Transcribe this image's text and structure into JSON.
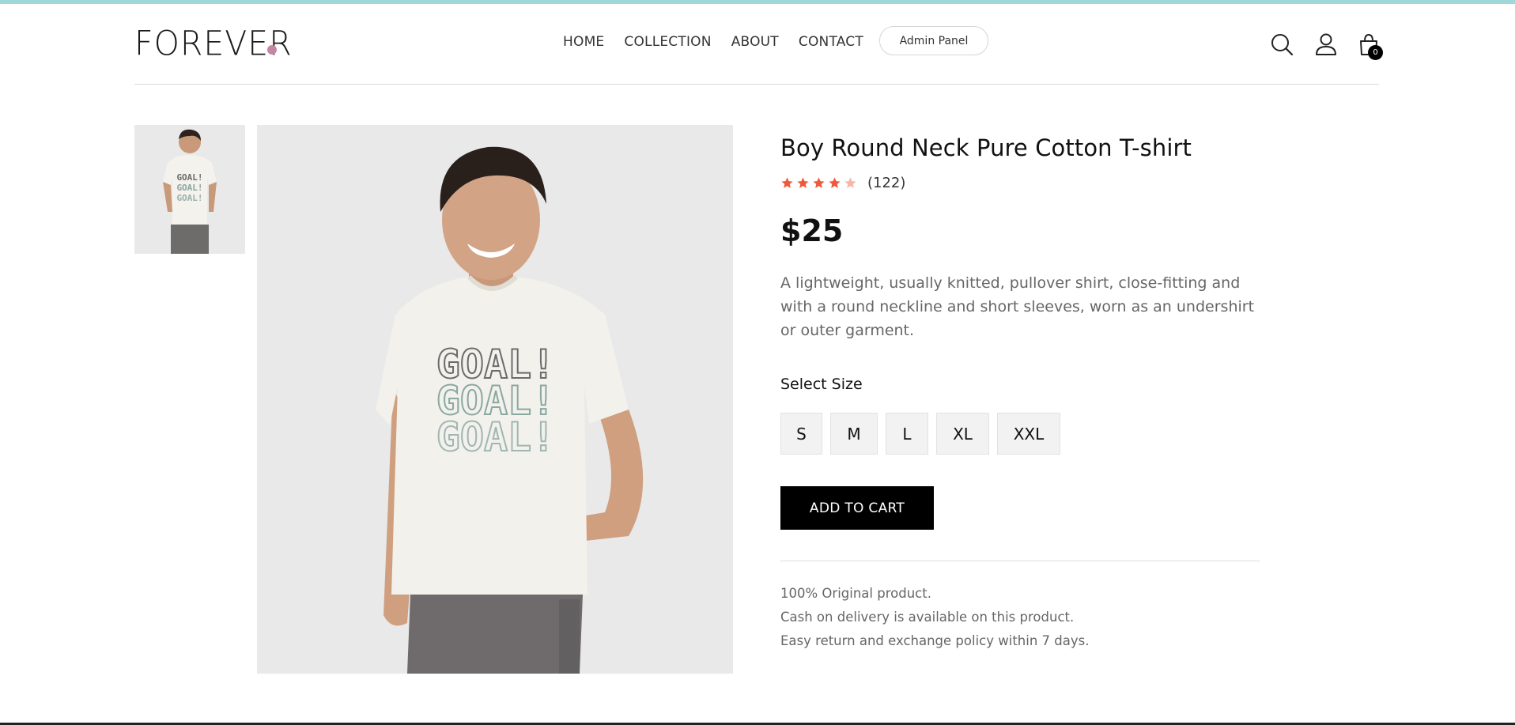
{
  "colors": {
    "accent_dot": "#c586a6",
    "star_filled": "#f0583a",
    "star_empty": "#f7b7a7",
    "button_bg": "#000000",
    "top_strip": "#9fd8d8"
  },
  "header": {
    "logo": "FOREVER",
    "nav": [
      {
        "label": "HOME"
      },
      {
        "label": "COLLECTION"
      },
      {
        "label": "ABOUT"
      },
      {
        "label": "CONTACT"
      }
    ],
    "admin_label": "Admin Panel",
    "icons": [
      "search-icon",
      "user-icon",
      "cart-icon"
    ],
    "cart_count": "0"
  },
  "product": {
    "title": "Boy Round Neck Pure Cotton T-shirt",
    "rating": 4,
    "rating_max": 5,
    "rating_count": "(122)",
    "price": "$25",
    "description": "A lightweight, usually knitted, pullover shirt, close-fitting and with a round neckline and short sleeves, worn as an undershirt or outer garment.",
    "size_label": "Select Size",
    "sizes": [
      {
        "label": "S"
      },
      {
        "label": "M"
      },
      {
        "label": "L"
      },
      {
        "label": "XL"
      },
      {
        "label": "XXL"
      }
    ],
    "add_to_cart": "ADD TO CART",
    "policies": [
      "100% Original product.",
      "Cash on delivery is available on this product.",
      "Easy return and exchange policy within 7 days."
    ],
    "image_text": [
      "GOAL!",
      "GOAL!",
      "GOAL!"
    ]
  }
}
